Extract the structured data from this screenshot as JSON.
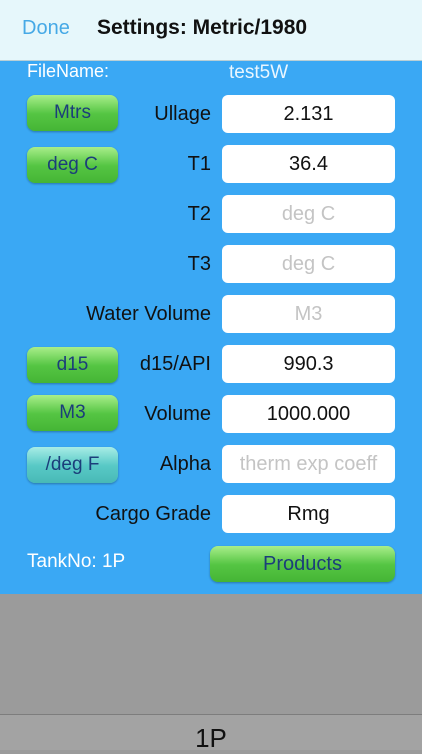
{
  "navbar": {
    "done_label": "Done",
    "title": "Settings: Metric/1980"
  },
  "file": {
    "label": "FileName:",
    "value": "test5W"
  },
  "rows": {
    "ullage": {
      "unit_button": "Mtrs",
      "label": "Ullage",
      "value": "2.131"
    },
    "t1": {
      "unit_button": "deg C",
      "label": "T1",
      "value": "36.4"
    },
    "t2": {
      "label": "T2",
      "placeholder": "deg C"
    },
    "t3": {
      "label": "T3",
      "placeholder": "deg C"
    },
    "water_volume": {
      "label": "Water Volume",
      "placeholder": "M3"
    },
    "d15": {
      "unit_button": "d15",
      "label": "d15/API",
      "value": "990.3"
    },
    "volume": {
      "unit_button": "M3",
      "label": "Volume",
      "value": "1000.000"
    },
    "alpha": {
      "unit_button": "/deg F",
      "label": "Alpha",
      "placeholder": "therm exp coeff"
    },
    "cargo_grade": {
      "label": "Cargo Grade",
      "value": "Rmg"
    }
  },
  "footer": {
    "tank_label": "TankNo: 1P",
    "products_button": "Products"
  },
  "picker": {
    "selected": "1P"
  },
  "colors": {
    "panel_bg": "#3aa8f4",
    "navbar_bg": "#e6f7fb",
    "button_green": "#55c543",
    "button_teal": "#58c9c6"
  }
}
